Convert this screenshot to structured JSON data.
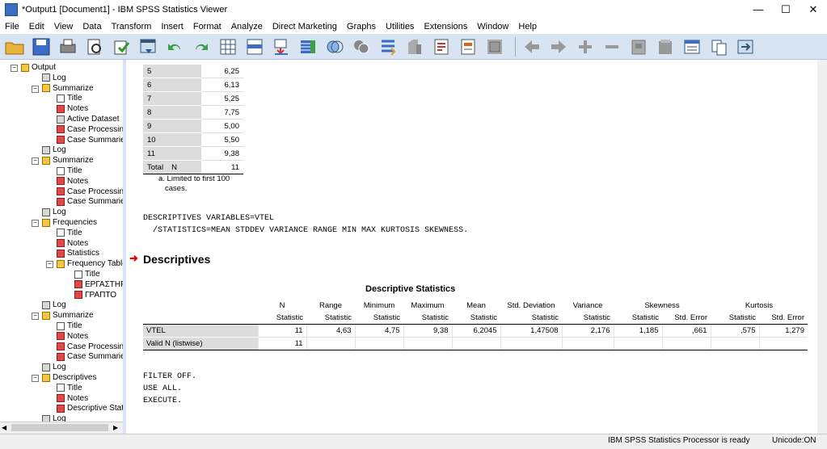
{
  "window": {
    "title": "*Output1 [Document1] - IBM SPSS Statistics Viewer",
    "controls": [
      "—",
      "☐",
      "✕"
    ]
  },
  "menu": [
    "File",
    "Edit",
    "View",
    "Data",
    "Transform",
    "Insert",
    "Format",
    "Analyze",
    "Direct Marketing",
    "Graphs",
    "Utilities",
    "Extensions",
    "Window",
    "Help"
  ],
  "toolbar": {
    "icons": [
      "open-folder-icon",
      "save-icon",
      "print-icon",
      "print-preview-icon",
      "export-icon",
      "recall-dialog-icon",
      "undo-icon",
      "redo-icon",
      "goto-data-icon",
      "goto-case-icon",
      "goto-variable-icon",
      "variables-icon",
      "pivot-icon",
      "chart-icon",
      "split-icon",
      "designate-window-icon",
      "insert-heading-icon",
      "insert-title-icon",
      "insert-text-icon",
      "back-icon",
      "forward-icon",
      "expand-icon",
      "collapse-icon",
      "show-icon",
      "hide-icon",
      "insert-output-icon",
      "move-up-icon",
      "pane-icon"
    ]
  },
  "tree": [
    {
      "label": "Output",
      "icon": "book",
      "level": 0
    },
    {
      "label": "Log",
      "icon": "log",
      "level": 1
    },
    {
      "label": "Summarize",
      "icon": "book",
      "level": 1
    },
    {
      "label": "Title",
      "icon": "doc",
      "level": 2
    },
    {
      "label": "Notes",
      "icon": "table",
      "level": 2
    },
    {
      "label": "Active Dataset",
      "icon": "log",
      "level": 2
    },
    {
      "label": "Case Processing",
      "icon": "table",
      "level": 2
    },
    {
      "label": "Case Summaries",
      "icon": "table",
      "level": 2
    },
    {
      "label": "Log",
      "icon": "log",
      "level": 1
    },
    {
      "label": "Summarize",
      "icon": "book",
      "level": 1
    },
    {
      "label": "Title",
      "icon": "doc",
      "level": 2
    },
    {
      "label": "Notes",
      "icon": "table",
      "level": 2
    },
    {
      "label": "Case Processing",
      "icon": "table",
      "level": 2
    },
    {
      "label": "Case Summaries",
      "icon": "table",
      "level": 2
    },
    {
      "label": "Log",
      "icon": "log",
      "level": 1
    },
    {
      "label": "Frequencies",
      "icon": "book",
      "level": 1
    },
    {
      "label": "Title",
      "icon": "doc",
      "level": 2
    },
    {
      "label": "Notes",
      "icon": "table",
      "level": 2
    },
    {
      "label": "Statistics",
      "icon": "table",
      "level": 2
    },
    {
      "label": "Frequency Table",
      "icon": "book",
      "level": 2
    },
    {
      "label": "Title",
      "icon": "doc",
      "level": 3
    },
    {
      "label": "ΕΡΓΑΣΤΗΡΙΟ",
      "icon": "table",
      "level": 3
    },
    {
      "label": "ΓΡΑΠΤΟ",
      "icon": "table",
      "level": 3
    },
    {
      "label": "Log",
      "icon": "log",
      "level": 1
    },
    {
      "label": "Summarize",
      "icon": "book",
      "level": 1
    },
    {
      "label": "Title",
      "icon": "doc",
      "level": 2
    },
    {
      "label": "Notes",
      "icon": "table",
      "level": 2
    },
    {
      "label": "Case Processing",
      "icon": "table",
      "level": 2
    },
    {
      "label": "Case Summaries",
      "icon": "table",
      "level": 2
    },
    {
      "label": "Log",
      "icon": "log",
      "level": 1
    },
    {
      "label": "Descriptives",
      "icon": "book",
      "level": 1
    },
    {
      "label": "Title",
      "icon": "doc",
      "level": 2
    },
    {
      "label": "Notes",
      "icon": "table",
      "level": 2
    },
    {
      "label": "Descriptive Statist",
      "icon": "table",
      "level": 2
    },
    {
      "label": "Log",
      "icon": "log",
      "level": 1
    }
  ],
  "case_summary": {
    "rows": [
      {
        "case": "5",
        "value": "6,25"
      },
      {
        "case": "6",
        "value": "6,13"
      },
      {
        "case": "7",
        "value": "5,25"
      },
      {
        "case": "8",
        "value": "7,75"
      },
      {
        "case": "9",
        "value": "5,00"
      },
      {
        "case": "10",
        "value": "5,50"
      },
      {
        "case": "11",
        "value": "9,38"
      }
    ],
    "total_label": "Total",
    "total_n_label": "N",
    "total_value": "11",
    "footnote_line1": "a. Limited to first 100",
    "footnote_line2": "cases."
  },
  "syntax1": {
    "line1": "DESCRIPTIVES VARIABLES=VTEL",
    "line2": "  /STATISTICS=MEAN STDDEV VARIANCE RANGE MIN MAX KURTOSIS SKEWNESS."
  },
  "section_title": "Descriptives",
  "desc_table": {
    "caption": "Descriptive Statistics",
    "headers": [
      "N",
      "Range",
      "Minimum",
      "Maximum",
      "Mean",
      "Std. Deviation",
      "Variance",
      "Skewness",
      "Kurtosis"
    ],
    "subheaders": [
      "Statistic",
      "Statistic",
      "Statistic",
      "Statistic",
      "Statistic",
      "Statistic",
      "Statistic",
      "Statistic",
      "Std. Error",
      "Statistic",
      "Std. Error"
    ],
    "rows": [
      {
        "label": "VTEL",
        "values": [
          "11",
          "4,63",
          "4,75",
          "9,38",
          "6,2045",
          "1,47508",
          "2,176",
          "1,185",
          ",661",
          ",575",
          "1,279"
        ]
      },
      {
        "label": "Valid N (listwise)",
        "values": [
          "11",
          "",
          "",
          "",
          "",
          "",
          "",
          "",
          "",
          "",
          ""
        ]
      }
    ]
  },
  "syntax2": {
    "line1": "FILTER OFF.",
    "line2": "USE ALL.",
    "line3": "EXECUTE."
  },
  "status": {
    "processor": "IBM SPSS Statistics Processor is ready",
    "unicode": "Unicode:ON"
  }
}
